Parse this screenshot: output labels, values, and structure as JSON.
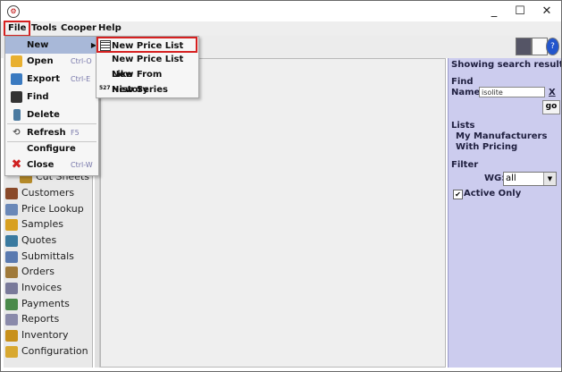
{
  "window": {
    "minimize": "_",
    "maximize": "☐",
    "close": "✕",
    "app_icon": "app-logo-icon"
  },
  "menubar": {
    "file": "File",
    "tools": "Tools",
    "cooper": "Cooper",
    "help": "Help"
  },
  "file_menu": {
    "items": [
      {
        "label": "New",
        "shortcut": "",
        "icon": "new-icon"
      },
      {
        "label": "Open",
        "shortcut": "Ctrl-O",
        "icon": "folder-open-icon"
      },
      {
        "label": "Export",
        "shortcut": "Ctrl-E",
        "icon": "export-icon"
      },
      {
        "label": "Find",
        "shortcut": "",
        "icon": "binoculars-icon"
      },
      {
        "label": "Delete",
        "shortcut": "",
        "icon": "trash-icon"
      },
      {
        "label": "Refresh",
        "shortcut": "F5",
        "icon": "refresh-icon"
      },
      {
        "label": "Configure",
        "shortcut": "",
        "icon": ""
      },
      {
        "label": "Close",
        "shortcut": "Ctrl-W",
        "icon": "close-x-icon"
      }
    ]
  },
  "new_submenu": {
    "items": [
      {
        "label": "New Price List",
        "icon": "grid-icon"
      },
      {
        "label": "New Price List Like",
        "icon": ""
      },
      {
        "label": "New From History",
        "icon": ""
      },
      {
        "label": "New Series",
        "icon": "series-icon",
        "icon_text": "527"
      }
    ]
  },
  "nav": {
    "items": [
      {
        "label": "Cut Sheets",
        "icon": "cut-sheets-icon"
      },
      {
        "label": "Customers",
        "icon": "customers-icon"
      },
      {
        "label": "Price Lookup",
        "icon": "price-lookup-icon"
      },
      {
        "label": "Samples",
        "icon": "samples-icon"
      },
      {
        "label": "Quotes",
        "icon": "quotes-icon"
      },
      {
        "label": "Submittals",
        "icon": "submittals-icon"
      },
      {
        "label": "Orders",
        "icon": "orders-icon"
      },
      {
        "label": "Invoices",
        "icon": "invoices-icon"
      },
      {
        "label": "Payments",
        "icon": "payments-icon"
      },
      {
        "label": "Reports",
        "icon": "reports-icon"
      },
      {
        "label": "Inventory",
        "icon": "inventory-icon"
      },
      {
        "label": "Configuration",
        "icon": "configuration-icon"
      }
    ]
  },
  "right_panel": {
    "heading": "Showing search results",
    "find_label": "Find",
    "name_label": "Name:",
    "name_value": "isolite",
    "clear": "X",
    "go": "go",
    "lists_label": "Lists",
    "list_links": [
      "My Manufacturers",
      "With Pricing"
    ],
    "filter_label": "Filter",
    "wg_label": "WG:",
    "wg_value": "all",
    "active_only": "Active Only",
    "active_only_checked": true
  },
  "colors": {
    "highlight": "#d62020",
    "right_panel_bg": "#ccccee",
    "link": "#1a1aaa",
    "menu_selected": "#a8b8d8"
  }
}
